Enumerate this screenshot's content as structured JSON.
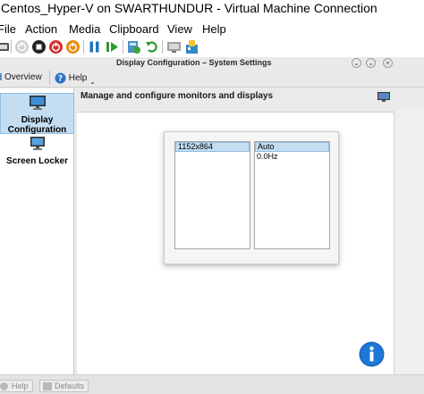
{
  "host": {
    "title": "Centos_Hyper-V on SWARTHUNDUR - Virtual Machine Connection",
    "menu": [
      "File",
      "Action",
      "Media",
      "Clipboard",
      "View",
      "Help"
    ],
    "toolbar_icons": [
      "ctrl-alt-del-icon",
      "start-icon",
      "turn-off-icon",
      "shut-down-icon",
      "save-icon",
      "pause-icon",
      "resume-icon",
      "checkpoint-icon",
      "revert-icon",
      "enhanced-session-icon",
      "zoom-icon"
    ]
  },
  "kde": {
    "title": "Display Configuration – System Settings",
    "toolbar": {
      "overview": "Overview",
      "help": "Help"
    },
    "sidebar": [
      {
        "label_line1": "Display",
        "label_line2": "Configuration",
        "icon": "display-icon",
        "selected": true
      },
      {
        "label_line1": "Screen Locker",
        "label_line2": "",
        "icon": "screen-locker-icon",
        "selected": false
      }
    ],
    "heading": "Manage and configure monitors and displays",
    "resolution": {
      "items": [
        "1152x864"
      ],
      "selected": "1152x864"
    },
    "refresh": {
      "items": [
        "Auto",
        "0.0Hz"
      ],
      "selected": "Auto"
    },
    "bottom": {
      "help": "Help",
      "defaults": "Defaults"
    }
  },
  "colors": {
    "selection": "#c3ddf2",
    "selection_border": "#93bde2",
    "info_button": "#1565c0",
    "start_green": "#2e9a2e",
    "shutdown_red": "#d32f2f",
    "save_orange": "#e68a00",
    "pause_blue": "#1e73be"
  }
}
